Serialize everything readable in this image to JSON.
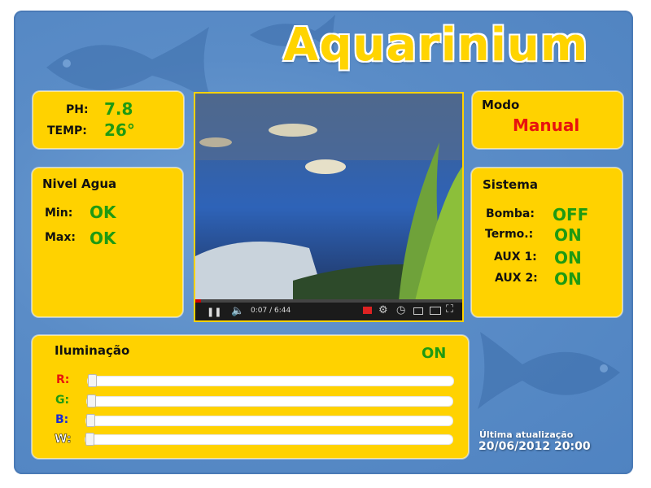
{
  "app": {
    "title": "Aquarinium"
  },
  "water": {
    "ph_label": "PH:",
    "ph_value": "7.8",
    "temp_label": "TEMP:",
    "temp_value": "26°"
  },
  "level": {
    "title": "Nivel Agua",
    "min_label": "Min:",
    "min_value": "OK",
    "max_label": "Max:",
    "max_value": "OK"
  },
  "mode": {
    "title": "Modo",
    "value": "Manual",
    "value_color": "#e8130e"
  },
  "system": {
    "title": "Sistema",
    "items": [
      {
        "label": "Bomba:",
        "value": "OFF"
      },
      {
        "label": "Termo.:",
        "value": "ON"
      },
      {
        "label": "AUX 1:",
        "value": "ON"
      },
      {
        "label": "AUX 2:",
        "value": "ON"
      }
    ]
  },
  "video": {
    "time": "0:07 / 6:44",
    "progress": 0.02
  },
  "lighting": {
    "title": "Iluminação",
    "status": "ON",
    "channels": [
      {
        "label": "R:",
        "color": "#e8130e",
        "level": 0
      },
      {
        "label": "G:",
        "color": "#1e9a12",
        "level": 0
      },
      {
        "label": "B:",
        "color": "#1a2bd6",
        "level": 0
      },
      {
        "label": "W:",
        "color": "#ffffff",
        "level": 0
      }
    ]
  },
  "updated": {
    "label": "Última atualização",
    "value": "20/06/2012 20:00"
  },
  "colors": {
    "accent": "#ffd200",
    "ok_green": "#1e9a12",
    "background": "#5a8cc7"
  }
}
